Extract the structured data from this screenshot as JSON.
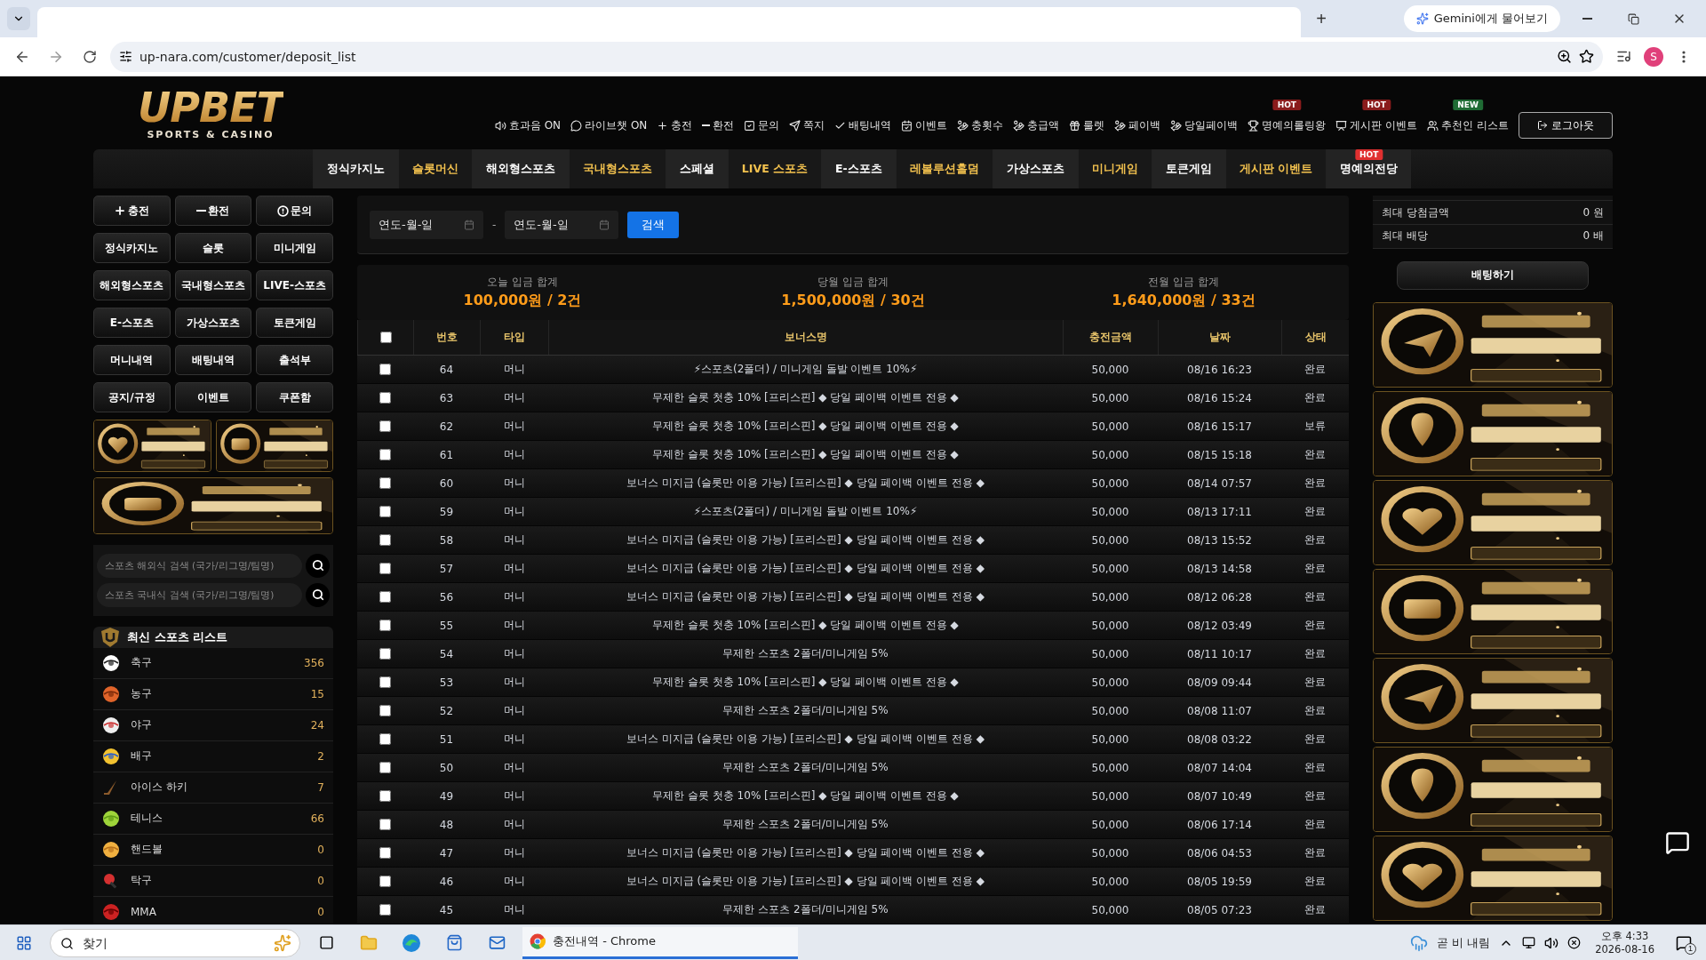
{
  "browser": {
    "new_tab": "+",
    "gemini": "Gemini에게 물어보기",
    "url": "up-nara.com/customer/deposit_list",
    "profile": "S"
  },
  "logo": {
    "name": "UPBET",
    "tagline": "SPORTS & CASINO"
  },
  "util_nav": [
    {
      "label": "효과음 ON"
    },
    {
      "label": "라이브챗 ON"
    },
    {
      "label": "충전"
    },
    {
      "label": "환전"
    },
    {
      "label": "문의"
    },
    {
      "label": "쪽지"
    },
    {
      "label": "배팅내역"
    },
    {
      "label": "이벤트"
    },
    {
      "label": "충횟수"
    },
    {
      "label": "충급액"
    },
    {
      "label": "룰렛"
    },
    {
      "label": "페이백"
    },
    {
      "label": "당일페이백"
    },
    {
      "label": "명예의롤링왕",
      "badge": "HOT"
    },
    {
      "label": "게시판 이벤트",
      "badge": "HOT"
    },
    {
      "label": "추천인 리스트",
      "badge": "NEW"
    }
  ],
  "logout": "로그아웃",
  "main_nav": [
    {
      "label": "정식카지노",
      "highlighted": false
    },
    {
      "label": "슬롯머신",
      "highlighted": true
    },
    {
      "label": "해외형스포츠",
      "highlighted": false
    },
    {
      "label": "국내형스포츠",
      "highlighted": true
    },
    {
      "label": "스페셜",
      "highlighted": false
    },
    {
      "label": "LIVE 스포츠",
      "highlighted": true
    },
    {
      "label": "E-스포츠",
      "highlighted": false
    },
    {
      "label": "레볼루션홀덤",
      "highlighted": true
    },
    {
      "label": "가상스포츠",
      "highlighted": false
    },
    {
      "label": "미니게임",
      "highlighted": true
    },
    {
      "label": "토큰게임",
      "highlighted": false
    },
    {
      "label": "게시판 이벤트",
      "highlighted": true
    },
    {
      "label": "명예의전당",
      "highlighted": false,
      "badge": "HOT"
    }
  ],
  "side_buttons": [
    "충전",
    "환전",
    "문의",
    "정식카지노",
    "슬롯",
    "미니게임",
    "해외형스포츠",
    "국내형스포츠",
    "LIVE-스포츠",
    "E-스포츠",
    "가상스포츠",
    "토큰게임",
    "머니내역",
    "배팅내역",
    "출석부",
    "공지/규정",
    "이벤트",
    "쿠폰함"
  ],
  "side_banners": [
    {
      "kind": "picture"
    },
    {
      "kind": "picture"
    },
    {
      "kind": "picture"
    }
  ],
  "sports_search": [
    {
      "placeholder": "스포츠 해외식 검색 (국가/리그명/팀명)"
    },
    {
      "placeholder": "스포츠 국내식 검색 (국가/리그명/팀명)"
    }
  ],
  "sports_list": {
    "title": "최신 스포츠 리스트",
    "items": [
      {
        "name": "축구",
        "count": "356"
      },
      {
        "name": "농구",
        "count": "15"
      },
      {
        "name": "야구",
        "count": "24"
      },
      {
        "name": "배구",
        "count": "2"
      },
      {
        "name": "아이스 하키",
        "count": "7"
      },
      {
        "name": "테니스",
        "count": "66"
      },
      {
        "name": "핸드볼",
        "count": "0"
      },
      {
        "name": "탁구",
        "count": "0"
      },
      {
        "name": "MMA",
        "count": "0"
      }
    ]
  },
  "filter": {
    "from": {
      "placeholder": "연도-월-일"
    },
    "separator": "-",
    "to": {
      "placeholder": "연도-월-일"
    },
    "search": "검색"
  },
  "summary": [
    {
      "label": "오늘 입금 합계",
      "value": "100,000원 / 2건"
    },
    {
      "label": "당월 입금 합계",
      "value": "1,500,000원 / 30건"
    },
    {
      "label": "전월 입금 합계",
      "value": "1,640,000원 / 33건"
    }
  ],
  "table": {
    "select_all": {
      "checked": false
    },
    "columns": [
      "번호",
      "타입",
      "보너스명",
      "충전금액",
      "날짜",
      "상태"
    ],
    "rows": [
      {
        "checked": false,
        "cells": [
          "64",
          "머니",
          "⚡스포츠(2폴더) / 미니게임 돌발 이벤트 10%⚡",
          "50,000",
          "08/16 16:23",
          "완료"
        ]
      },
      {
        "checked": false,
        "cells": [
          "63",
          "머니",
          "무제한 슬롯 첫충 10% [프리스핀] ◆ 당일 페이백 이벤트 전용 ◆",
          "50,000",
          "08/16 15:24",
          "완료"
        ]
      },
      {
        "checked": false,
        "cells": [
          "62",
          "머니",
          "무제한 슬롯 첫충 10% [프리스핀] ◆ 당일 페이백 이벤트 전용 ◆",
          "50,000",
          "08/16 15:17",
          "보류"
        ]
      },
      {
        "checked": false,
        "cells": [
          "61",
          "머니",
          "무제한 슬롯 첫충 10% [프리스핀] ◆ 당일 페이백 이벤트 전용 ◆",
          "50,000",
          "08/15 15:18",
          "완료"
        ]
      },
      {
        "checked": false,
        "cells": [
          "60",
          "머니",
          "보너스 미지급 (슬롯만 이용 가능) [프리스핀] ◆ 당일 페이백 이벤트 전용 ◆",
          "50,000",
          "08/14 07:57",
          "완료"
        ]
      },
      {
        "checked": false,
        "cells": [
          "59",
          "머니",
          "⚡스포츠(2폴더) / 미니게임 돌발 이벤트 10%⚡",
          "50,000",
          "08/13 17:11",
          "완료"
        ]
      },
      {
        "checked": false,
        "cells": [
          "58",
          "머니",
          "보너스 미지급 (슬롯만 이용 가능) [프리스핀] ◆ 당일 페이백 이벤트 전용 ◆",
          "50,000",
          "08/13 15:52",
          "완료"
        ]
      },
      {
        "checked": false,
        "cells": [
          "57",
          "머니",
          "보너스 미지급 (슬롯만 이용 가능) [프리스핀] ◆ 당일 페이백 이벤트 전용 ◆",
          "50,000",
          "08/13 14:58",
          "완료"
        ]
      },
      {
        "checked": false,
        "cells": [
          "56",
          "머니",
          "보너스 미지급 (슬롯만 이용 가능) [프리스핀] ◆ 당일 페이백 이벤트 전용 ◆",
          "50,000",
          "08/12 06:28",
          "완료"
        ]
      },
      {
        "checked": false,
        "cells": [
          "55",
          "머니",
          "무제한 슬롯 첫충 10% [프리스핀] ◆ 당일 페이백 이벤트 전용 ◆",
          "50,000",
          "08/12 03:49",
          "완료"
        ]
      },
      {
        "checked": false,
        "cells": [
          "54",
          "머니",
          "무제한 스포츠 2폴더/미니게임 5%",
          "50,000",
          "08/11 10:17",
          "완료"
        ]
      },
      {
        "checked": false,
        "cells": [
          "53",
          "머니",
          "무제한 슬롯 첫충 10% [프리스핀] ◆ 당일 페이백 이벤트 전용 ◆",
          "50,000",
          "08/09 09:44",
          "완료"
        ]
      },
      {
        "checked": false,
        "cells": [
          "52",
          "머니",
          "무제한 스포츠 2폴더/미니게임 5%",
          "50,000",
          "08/08 11:07",
          "완료"
        ]
      },
      {
        "checked": false,
        "cells": [
          "51",
          "머니",
          "보너스 미지급 (슬롯만 이용 가능) [프리스핀] ◆ 당일 페이백 이벤트 전용 ◆",
          "50,000",
          "08/08 03:22",
          "완료"
        ]
      },
      {
        "checked": false,
        "cells": [
          "50",
          "머니",
          "무제한 스포츠 2폴더/미니게임 5%",
          "50,000",
          "08/07 14:04",
          "완료"
        ]
      },
      {
        "checked": false,
        "cells": [
          "49",
          "머니",
          "무제한 슬롯 첫충 10% [프리스핀] ◆ 당일 페이백 이벤트 전용 ◆",
          "50,000",
          "08/07 10:49",
          "완료"
        ]
      },
      {
        "checked": false,
        "cells": [
          "48",
          "머니",
          "무제한 스포츠 2폴더/미니게임 5%",
          "50,000",
          "08/06 17:14",
          "완료"
        ]
      },
      {
        "checked": false,
        "cells": [
          "47",
          "머니",
          "보너스 미지급 (슬롯만 이용 가능) [프리스핀] ◆ 당일 페이백 이벤트 전용 ◆",
          "50,000",
          "08/06 04:53",
          "완료"
        ]
      },
      {
        "checked": false,
        "cells": [
          "46",
          "머니",
          "보너스 미지급 (슬롯만 이용 가능) [프리스핀] ◆ 당일 페이백 이벤트 전용 ◆",
          "50,000",
          "08/05 19:59",
          "완료"
        ]
      },
      {
        "checked": false,
        "cells": [
          "45",
          "머니",
          "무제한 스포츠 2폴더/미니게임 5%",
          "50,000",
          "08/05 07:23",
          "완료"
        ]
      }
    ]
  },
  "bet_slip": {
    "stats": [
      {
        "label": "최대 당첨금액",
        "value": "0 원"
      },
      {
        "label": "최대 배당",
        "value": "0 배"
      }
    ],
    "button": "배팅하기"
  },
  "right_banners": [
    {
      "kind": "picture"
    },
    {
      "kind": "picture"
    },
    {
      "kind": "picture"
    },
    {
      "kind": "picture"
    },
    {
      "kind": "picture"
    },
    {
      "kind": "picture"
    },
    {
      "kind": "picture"
    }
  ],
  "taskbar": {
    "search": {
      "placeholder": "찾기"
    },
    "app": "충전내역 - Chrome",
    "weather": "곧 비 내림",
    "time": "오후 4:33",
    "date": "2026-08-16",
    "notifications": "1"
  }
}
